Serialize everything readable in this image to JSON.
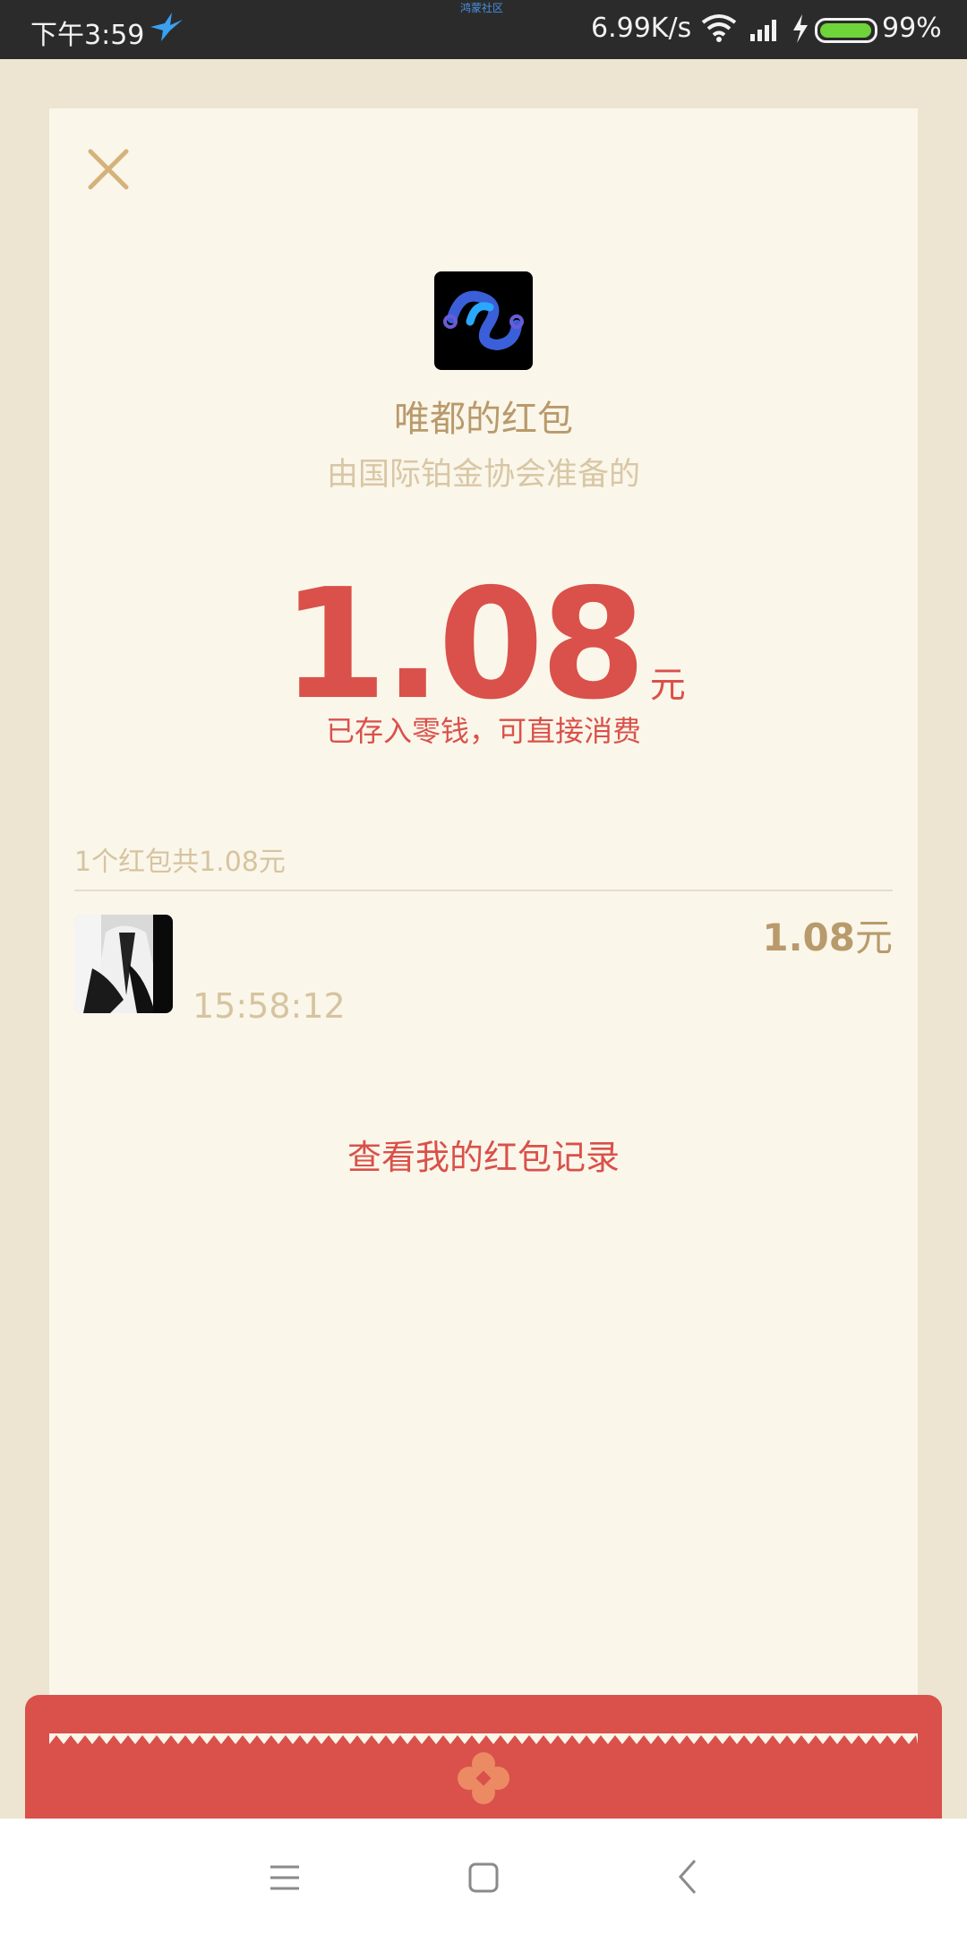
{
  "status_bar": {
    "time": "下午3:59",
    "center_text": "鸿蒙社区",
    "network_speed": "6.99K/s",
    "battery_percent": "99%",
    "battery_level": 0.99
  },
  "packet": {
    "title": "唯都的红包",
    "subtitle": "由国际铂金协会准备的",
    "amount": "1.08",
    "amount_unit": "元",
    "stored_notice": "已存入零钱，可直接消费"
  },
  "summary": {
    "count_text": "1个红包共1.08元"
  },
  "records": [
    {
      "time": "15:58:12",
      "amount": "1.08",
      "unit": "元"
    }
  ],
  "history_link": "查看我的红包记录",
  "colors": {
    "accent_red": "#d9514a",
    "gold": "#b89a6b",
    "light_gold": "#d6c4a0",
    "card_bg": "#fbf6ea",
    "page_bg": "#ede4d2"
  },
  "icons": {
    "close": "close-icon",
    "menu": "menu-icon",
    "home": "home-icon",
    "back": "back-icon"
  }
}
